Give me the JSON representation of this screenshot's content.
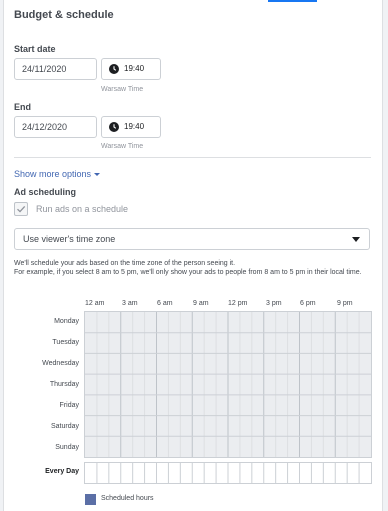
{
  "section": {
    "title": "Budget & schedule"
  },
  "start": {
    "label": "Start date",
    "date": "24/11/2020",
    "time": "19:40",
    "timezone": "Warsaw Time"
  },
  "end": {
    "label": "End",
    "date": "24/12/2020",
    "time": "19:40",
    "timezone": "Warsaw Time"
  },
  "show_more": {
    "label": "Show more options"
  },
  "ad_scheduling": {
    "title": "Ad scheduling",
    "checkbox_label": "Run ads on a schedule",
    "checkbox_checked": true,
    "checkbox_disabled": true
  },
  "timezone_select": {
    "value": "Use viewer's time zone"
  },
  "help_text": [
    "We'll schedule your ads based on the time zone of the person seeing it.",
    "For example, if you select 8 am to 5 pm, we'll only show your ads to people from 8 am to 5 pm in their local time."
  ],
  "schedule": {
    "hours": [
      "12 am",
      "3 am",
      "6 am",
      "9 am",
      "12 pm",
      "3 pm",
      "6 pm",
      "9 pm"
    ],
    "days": [
      "Monday",
      "Tuesday",
      "Wednesday",
      "Thursday",
      "Friday",
      "Saturday",
      "Sunday"
    ],
    "every_day_label": "Every Day",
    "legend_label": "Scheduled hours",
    "legend_color": "#5b6fa6"
  },
  "colors": {
    "accent": "#4267b2",
    "tab_indicator": "#1877f2"
  }
}
